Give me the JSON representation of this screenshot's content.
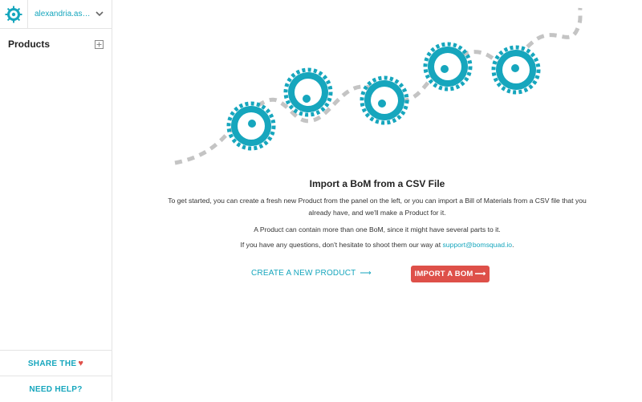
{
  "account": {
    "name": "alexandria.ashaw...",
    "logo_icon": "gear-logo-icon",
    "dropdown_icon": "chevron-down-icon"
  },
  "sidebar": {
    "products_title": "Products",
    "add_icon": "plus-square-icon",
    "share_label": "SHARE THE",
    "share_heart": "♥",
    "help_label": "NEED HELP?"
  },
  "main": {
    "title": "Import a BoM from a CSV File",
    "paragraph1": "To get started, you can create a fresh new Product from the panel on the left, or you can import a Bill of Materials from a CSV file that you already have, and we'll make a Product for it.",
    "paragraph2": "A Product can contain more than one BoM, since it might have several parts to it.",
    "paragraph3_prefix": "If you have any questions, don't hesitate to shoot them our way at ",
    "support_email": "support@bomsquad.io",
    "paragraph3_suffix": ".",
    "create_label": "CREATE A NEW PRODUCT",
    "import_label": "IMPORT A BOM",
    "arrow": "⟶"
  },
  "colors": {
    "accent": "#16a6bd",
    "danger": "#de5049",
    "gear": "#16a6bd",
    "path": "#bbbbbb"
  }
}
